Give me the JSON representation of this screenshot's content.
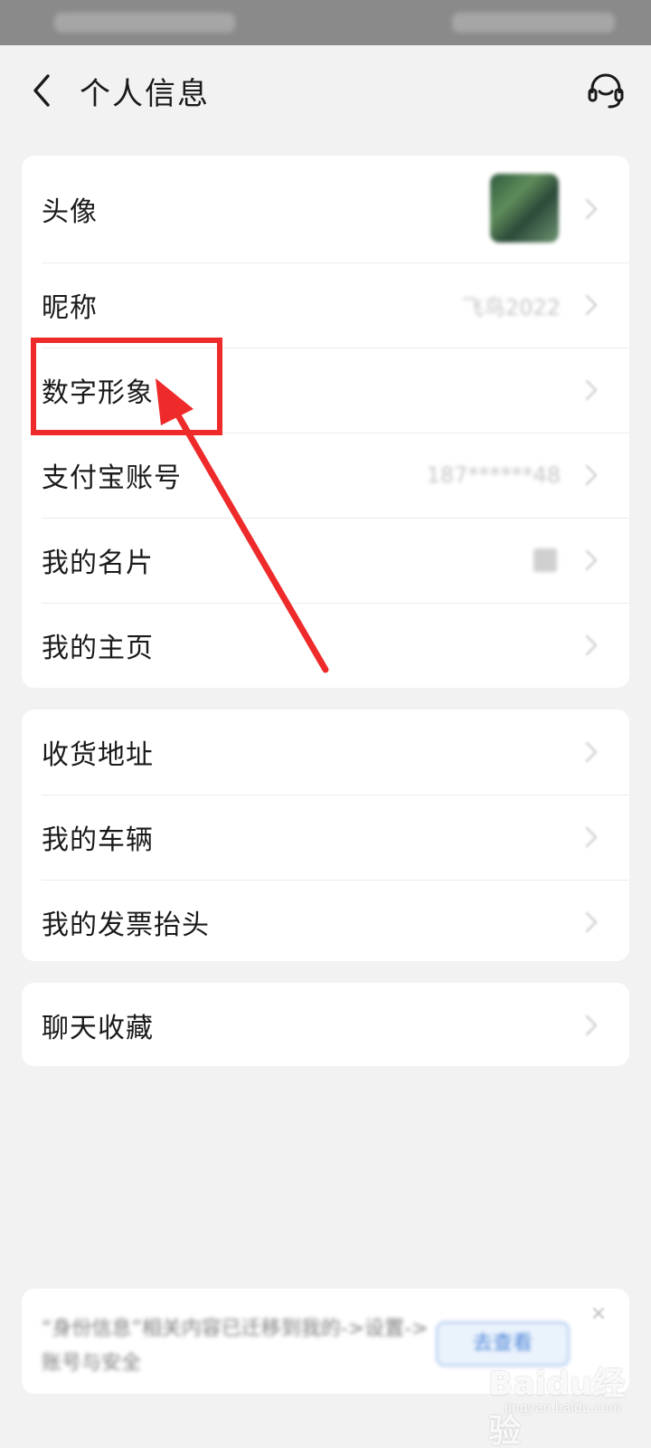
{
  "status_bar": {
    "left_text": "",
    "right_text": ""
  },
  "header": {
    "title": "个人信息"
  },
  "card1": {
    "rows": [
      {
        "label": "头像",
        "value": ""
      },
      {
        "label": "昵称",
        "value": "飞鸟2022"
      },
      {
        "label": "数字形象",
        "value": ""
      },
      {
        "label": "支付宝账号",
        "value": "187******48"
      },
      {
        "label": "我的名片",
        "value": ""
      },
      {
        "label": "我的主页",
        "value": ""
      }
    ]
  },
  "card2": {
    "rows": [
      {
        "label": "收货地址"
      },
      {
        "label": "我的车辆"
      },
      {
        "label": "我的发票抬头"
      }
    ]
  },
  "card3": {
    "rows": [
      {
        "label": "聊天收藏"
      }
    ]
  },
  "banner": {
    "text": "“身份信息”相关内容已迁移到我的->设置->账号与安全",
    "button": "去查看",
    "close": "×"
  },
  "watermark": {
    "main": "Baidu经验",
    "sub": "jingyan.baidu.com"
  },
  "colors": {
    "annotation": "#ee2a2a",
    "background": "#f2f2f2",
    "card": "#ffffff"
  },
  "icons": {
    "back": "chevron-left-icon",
    "support": "headset-icon",
    "row": "chevron-right-icon"
  }
}
